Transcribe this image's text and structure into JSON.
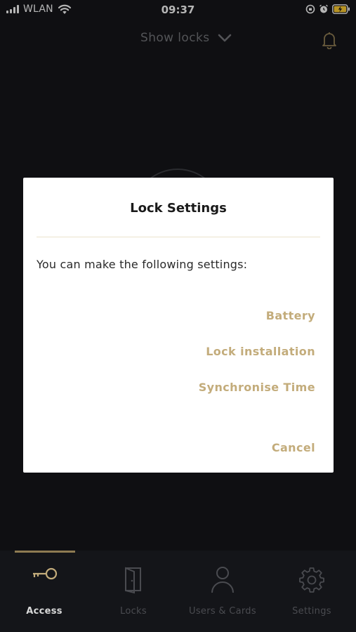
{
  "status_bar": {
    "carrier": "WLAN",
    "time": "09:37"
  },
  "header": {
    "show_locks_label": "Show locks"
  },
  "dialog": {
    "title": "Lock Settings",
    "message": "You can make the following settings:",
    "actions": [
      "Battery",
      "Lock installation",
      "Synchronise Time"
    ],
    "cancel_label": "Cancel"
  },
  "tabs": [
    {
      "label": "Access",
      "icon": "key-icon",
      "active": true
    },
    {
      "label": "Locks",
      "icon": "door-icon",
      "active": false
    },
    {
      "label": "Users & Cards",
      "icon": "user-icon",
      "active": false
    },
    {
      "label": "Settings",
      "icon": "gear-icon",
      "active": false
    }
  ],
  "colors": {
    "background": "#141519",
    "accent_gold": "#c3ac7b",
    "dialog_background": "#ffffff"
  }
}
